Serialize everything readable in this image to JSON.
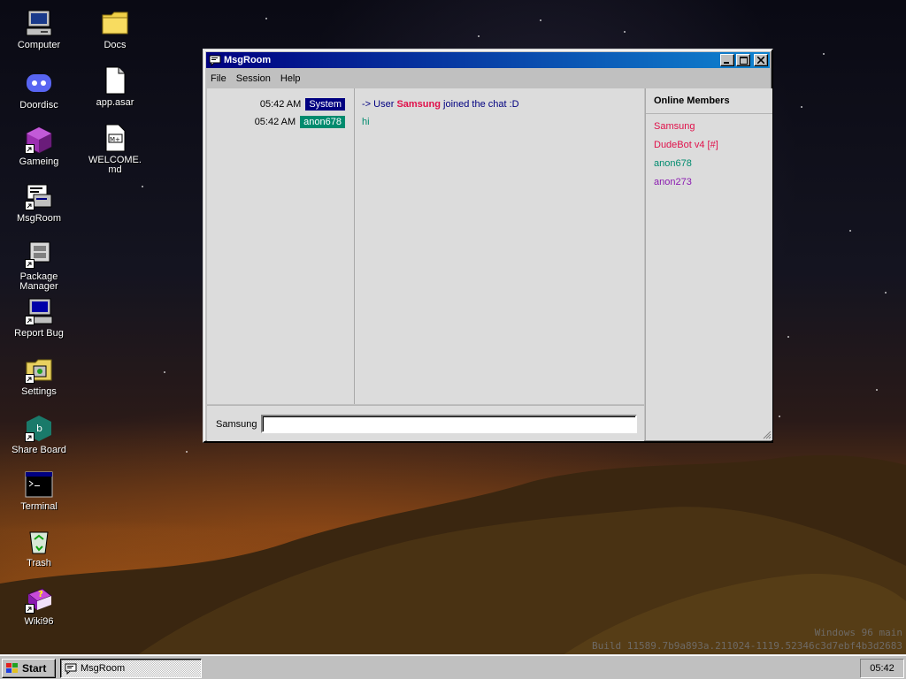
{
  "desktop": {
    "icons": [
      {
        "label": "Computer",
        "icon": "computer-icon"
      },
      {
        "label": "Docs",
        "icon": "folder-icon"
      },
      {
        "label": "Doordisc",
        "icon": "discord-icon"
      },
      {
        "label": "app.asar",
        "icon": "file-icon"
      },
      {
        "label": "Gameing",
        "icon": "game-cube-icon"
      },
      {
        "label": "WELCOME.md",
        "icon": "markdown-file-icon"
      },
      {
        "label": "MsgRoom",
        "icon": "msgroom-icon"
      },
      {
        "label": "Package Manager",
        "icon": "package-manager-icon"
      },
      {
        "label": "Report Bug",
        "icon": "report-bug-icon"
      },
      {
        "label": "Settings",
        "icon": "settings-icon"
      },
      {
        "label": "Share Board",
        "icon": "share-board-icon"
      },
      {
        "label": "Terminal",
        "icon": "terminal-icon"
      },
      {
        "label": "Trash",
        "icon": "recycle-bin-icon"
      },
      {
        "label": "Wiki96",
        "icon": "wiki-book-icon"
      }
    ],
    "build_info": {
      "line1": "Windows 96 main",
      "line2": "Build 11589.7b9a893a.211024-1119.52346c3d7ebf4b3d2683"
    }
  },
  "window": {
    "title": "MsgRoom",
    "menu": [
      "File",
      "Session",
      "Help"
    ],
    "timeline": [
      {
        "time": "05:42 AM",
        "user": "System",
        "color": "#000080"
      },
      {
        "time": "05:42 AM",
        "user": "anon678",
        "color": "#008b6e"
      }
    ],
    "messages": [
      {
        "prefix": "-> User ",
        "name": "Samsung",
        "suffix": " joined the chat :D",
        "color": "#000080",
        "name_color": "#e0104a"
      },
      {
        "text": "hi",
        "color": "#008b6e"
      }
    ],
    "input": {
      "nick": "Samsung",
      "value": ""
    },
    "members_title": "Online Members",
    "members": [
      {
        "name": "Samsung",
        "color": "#e0104a"
      },
      {
        "name": "DudeBot v4 [#]",
        "color": "#e0104a"
      },
      {
        "name": "anon678",
        "color": "#008b6e"
      },
      {
        "name": "anon273",
        "color": "#8a1ab0"
      }
    ]
  },
  "taskbar": {
    "start_label": "Start",
    "task_label": "MsgRoom",
    "clock": "05:42"
  }
}
